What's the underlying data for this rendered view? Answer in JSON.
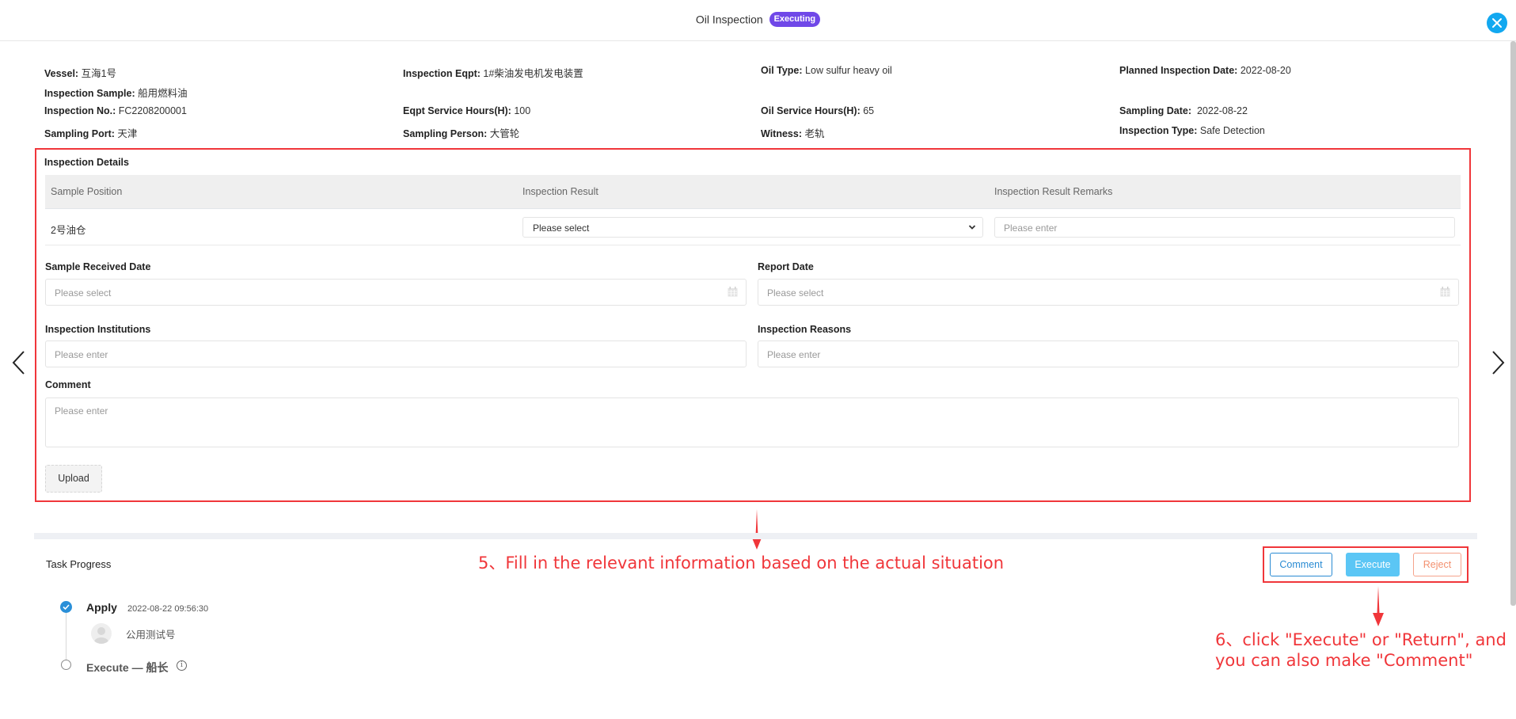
{
  "header": {
    "title": "Oil Inspection",
    "status_badge": "Executing",
    "colors": {
      "badge": "#7048e8",
      "close": "#12a8f0"
    }
  },
  "info": {
    "vessel": {
      "label": "Vessel:",
      "value": "互海1号"
    },
    "inspection_eqpt": {
      "label": "Inspection Eqpt:",
      "value": "1#柴油发电机发电装置"
    },
    "oil_type": {
      "label": "Oil Type:",
      "value": "Low sulfur heavy oil"
    },
    "planned_inspection_date": {
      "label": "Planned Inspection Date:",
      "value": "2022-08-20"
    },
    "inspection_sample": {
      "label": "Inspection Sample:",
      "value": "船用燃料油"
    },
    "inspection_no": {
      "label": "Inspection No.:",
      "value": "FC2208200001"
    },
    "eqpt_service_hours": {
      "label": "Eqpt Service Hours(H):",
      "value": "100"
    },
    "oil_service_hours": {
      "label": "Oil Service Hours(H):",
      "value": "65"
    },
    "sampling_date": {
      "label": "Sampling Date:",
      "value": "2022-08-22"
    },
    "sampling_port": {
      "label": "Sampling Port:",
      "value": "天津"
    },
    "sampling_person": {
      "label": "Sampling Person:",
      "value": "大管轮"
    },
    "witness": {
      "label": "Witness:",
      "value": "老轨"
    },
    "inspection_type": {
      "label": "Inspection Type:",
      "value": "Safe Detection"
    }
  },
  "details": {
    "title": "Inspection Details",
    "columns": [
      "Sample Position",
      "Inspection Result",
      "Inspection Result Remarks"
    ],
    "rows": [
      {
        "sample_position": "2号油仓",
        "inspection_result": "Please select",
        "remarks_placeholder": "Please enter"
      }
    ]
  },
  "form": {
    "sample_received_date": {
      "label": "Sample Received Date",
      "placeholder": "Please select"
    },
    "report_date": {
      "label": "Report Date",
      "placeholder": "Please select"
    },
    "inspection_institutions": {
      "label": "Inspection Institutions",
      "placeholder": "Please enter"
    },
    "inspection_reasons": {
      "label": "Inspection Reasons",
      "placeholder": "Please enter"
    },
    "comment": {
      "label": "Comment",
      "placeholder": "Please enter"
    },
    "upload_label": "Upload"
  },
  "task_progress": {
    "title": "Task Progress",
    "steps": [
      {
        "title": "Apply",
        "time": "2022-08-22 09:56:30",
        "user": "公用测试号",
        "done": true
      },
      {
        "title": "Execute — 船长",
        "done": false
      }
    ]
  },
  "actions": {
    "comment": "Comment",
    "execute": "Execute",
    "reject": "Reject"
  },
  "annotations": {
    "step5": "5、Fill in the relevant information based on the actual situation",
    "step6_line1": "6、click \"Execute\" or \"Return\", and",
    "step6_line2": "you can also make \"Comment\""
  }
}
